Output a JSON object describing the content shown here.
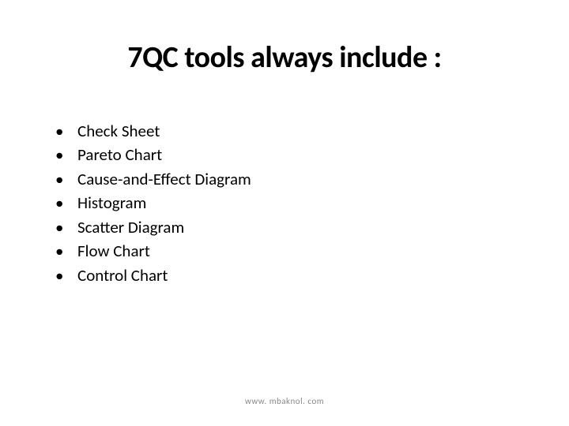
{
  "slide": {
    "title": "7QC tools always include :",
    "bullets": [
      "Check Sheet",
      "Pareto Chart",
      "Cause-and-Effect Diagram",
      "Histogram",
      "Scatter Diagram",
      "Flow Chart",
      "Control Chart"
    ],
    "footer": "www. mbaknol. com"
  }
}
